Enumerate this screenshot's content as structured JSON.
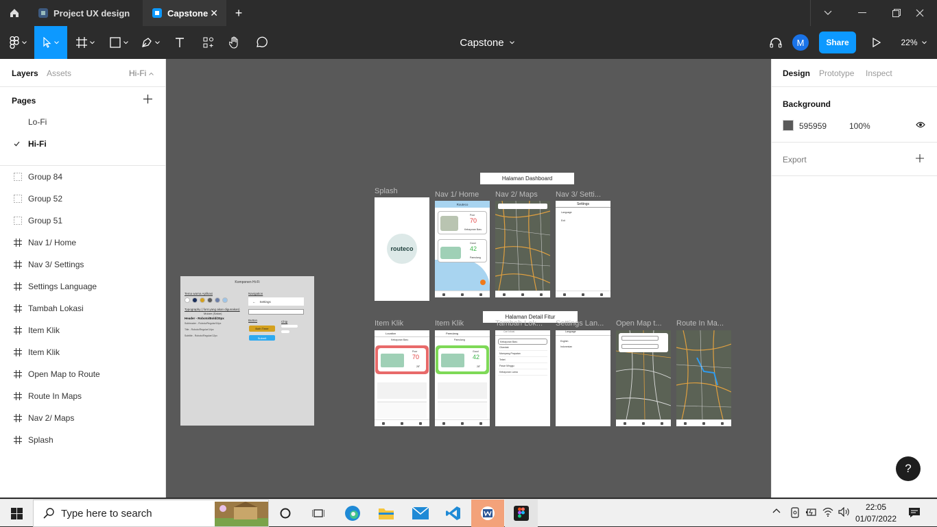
{
  "tabs": {
    "home_icon": "home-icon",
    "items": [
      {
        "label": "Project UX design"
      },
      {
        "label": "Capstone"
      }
    ],
    "new_tab": "+"
  },
  "toolbar": {
    "file_title": "Capstone",
    "share_label": "Share",
    "zoom": "22%",
    "avatar_initial": "M"
  },
  "left_panel": {
    "tabs": {
      "layers": "Layers",
      "assets": "Assets",
      "page_selector": "Hi-Fi"
    },
    "pages_heading": "Pages",
    "pages": [
      {
        "label": "Lo-Fi",
        "selected": false
      },
      {
        "label": "Hi-Fi",
        "selected": true
      }
    ],
    "layers": [
      {
        "label": "Group 84",
        "type": "group"
      },
      {
        "label": "Group 52",
        "type": "group"
      },
      {
        "label": "Group 51",
        "type": "group"
      },
      {
        "label": "Nav 1/ Home",
        "type": "frame"
      },
      {
        "label": "Nav 3/ Settings",
        "type": "frame"
      },
      {
        "label": "Settings Language",
        "type": "frame"
      },
      {
        "label": "Tambah Lokasi",
        "type": "frame"
      },
      {
        "label": "Item Klik",
        "type": "frame"
      },
      {
        "label": "Item Klik",
        "type": "frame"
      },
      {
        "label": "Open Map to Route",
        "type": "frame"
      },
      {
        "label": "Route In Maps",
        "type": "frame"
      },
      {
        "label": "Nav 2/ Maps",
        "type": "frame"
      },
      {
        "label": "Splash",
        "type": "frame"
      }
    ]
  },
  "canvas": {
    "background": "#595959",
    "section_dashboard": "Halaman Dashboard",
    "section_detail": "Halaman Detail Fitur",
    "frame_labels": {
      "splash": "Splash",
      "nav1": "Nav 1/ Home",
      "nav2": "Nav 2/ Maps",
      "nav3": "Nav 3/ Setti...",
      "item1": "Item Klik",
      "item2": "Item Klik",
      "tambah": "Tambah Lok...",
      "settings_lang": "Settings Lan...",
      "open_map": "Open Map t...",
      "route": "Route In Ma..."
    },
    "splash_logo": "routeco",
    "nav1_header": "Routeco",
    "nav1_cards": [
      {
        "status": "Poor",
        "value": "70",
        "place": "Kebayoran Baru"
      },
      {
        "status": "Good",
        "value": "42",
        "place": "Pamulang"
      }
    ],
    "nav3_header": "Settings",
    "nav3_items": [
      "Language",
      "Exit"
    ],
    "item1": {
      "header": "Location",
      "place": "Kebayoran Baru",
      "status": "Poor",
      "value": "70",
      "temp": "28°"
    },
    "item2": {
      "header": "Pamulang",
      "place": "Pamulang",
      "status": "Good",
      "value": "42",
      "temp": "28°"
    },
    "tambah_search": "Cari lokasi",
    "tambah_list": [
      "Kebayoran Baru",
      "Cilandak",
      "Mampang Prapatan",
      "Tebet",
      "Pasar Minggu",
      "Kebayoran Lama"
    ],
    "settings_lang_header": "Language",
    "settings_lang_list": [
      "English",
      "Indonesian"
    ],
    "komponen": {
      "title": "Komponen Hi-Fi",
      "tema": "Tema warna Aplikasi",
      "typo": "Typography ( font yang akan digunakan)",
      "font_name": "Moiare (Satoe)",
      "header": "Header - Roboto/Bold/20px",
      "sub1": "Subheader - Roboto/Regular/16px",
      "sub2": "Title - Roboto/Regular/14px",
      "sub3": "Subtitle - Roboto/Regular/12px",
      "navigation": "Navigation",
      "settings": "Settings",
      "button": "Button",
      "chip": "Chip",
      "btn1": "Both Timer",
      "btn2": "Submit"
    },
    "palette": [
      "#ffffff",
      "#1a2e5a",
      "#d4a11e",
      "#5a5a5a",
      "#6c7fa8",
      "#9ec5e8"
    ]
  },
  "right_panel": {
    "tabs": {
      "design": "Design",
      "prototype": "Prototype",
      "inspect": "Inspect"
    },
    "background_heading": "Background",
    "background_hex": "595959",
    "background_opacity": "100%",
    "export_heading": "Export",
    "help": "?"
  },
  "taskbar": {
    "search_placeholder": "Type here to search",
    "time": "22:05",
    "date": "01/07/2022"
  }
}
